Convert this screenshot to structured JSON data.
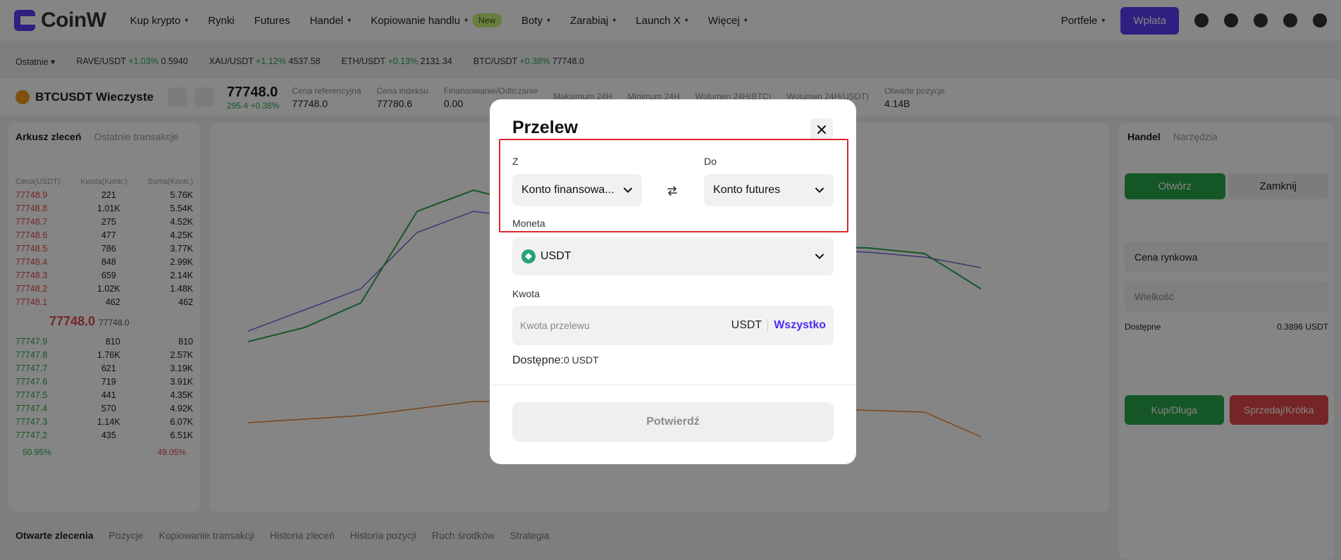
{
  "nav": {
    "brand": "CoinW",
    "items": [
      "Kup krypto",
      "Rynki",
      "Futures",
      "Handel",
      "Kopiowanie handlu",
      "Boty",
      "Zarabiaj",
      "Launch X",
      "Więcej"
    ],
    "new_badge": "New",
    "wallets": "Portfele",
    "deposit": "Wpłata"
  },
  "ticker": {
    "recent": "Ostatnie",
    "items": [
      {
        "pair": "RAVE/USDT",
        "change": "+1.03%",
        "price": "0.5940"
      },
      {
        "pair": "XAU/USDT",
        "change": "+1.12%",
        "price": "4537.58"
      },
      {
        "pair": "ETH/USDT",
        "change": "+0.13%",
        "price": "2131.34"
      },
      {
        "pair": "BTC/USDT",
        "change": "+0.38%",
        "price": "77748.0"
      }
    ]
  },
  "symbol": {
    "name": "BTCUSDT Wieczyste",
    "price": "77748.0",
    "change": "295.4 +0.38%",
    "stats": [
      {
        "label": "Cena referencyjna",
        "value": "77748.0"
      },
      {
        "label": "Cena indeksu",
        "value": "77780.6"
      },
      {
        "label": "Finansowanie/Odliczanie",
        "value": "0.00"
      },
      {
        "label": "Maksimum 24H",
        "value": ""
      },
      {
        "label": "Minimum 24H",
        "value": ""
      },
      {
        "label": "Wolumen 24H(BTC)",
        "value": ""
      },
      {
        "label": "Wolumen 24H(USDT)",
        "value": ""
      },
      {
        "label": "Otwarte pozycje",
        "value": "4.14B"
      }
    ]
  },
  "orderbook": {
    "tab1": "Arkusz zleceń",
    "tab2": "Ostatnie transakcje",
    "headers": [
      "Cena(USDT)",
      "Kwota(Kontr.)",
      "Suma(Kontr.)"
    ],
    "asks": [
      [
        "77748.9",
        "221",
        "5.76K"
      ],
      [
        "77748.8",
        "1.01K",
        "5.54K"
      ],
      [
        "77748.7",
        "275",
        "4.52K"
      ],
      [
        "77748.6",
        "477",
        "4.25K"
      ],
      [
        "77748.5",
        "786",
        "3.77K"
      ],
      [
        "77748.4",
        "848",
        "2.99K"
      ],
      [
        "77748.3",
        "659",
        "2.14K"
      ],
      [
        "77748.2",
        "1.02K",
        "1.48K"
      ],
      [
        "77748.1",
        "462",
        "462"
      ]
    ],
    "mid": "77748.0",
    "mid_ref": "77748.0",
    "bids": [
      [
        "77747.9",
        "810",
        "810"
      ],
      [
        "77747.8",
        "1.76K",
        "2.57K"
      ],
      [
        "77747.7",
        "621",
        "3.19K"
      ],
      [
        "77747.6",
        "719",
        "3.91K"
      ],
      [
        "77747.5",
        "441",
        "4.35K"
      ],
      [
        "77747.4",
        "570",
        "4.92K"
      ],
      [
        "77747.3",
        "1.14K",
        "6.07K"
      ],
      [
        "77747.2",
        "435",
        "6.51K"
      ]
    ],
    "buy_ratio": "50.95%",
    "sell_ratio": "49.05%"
  },
  "bottom_tabs": [
    "Otwarte zlecenia",
    "Pozycje",
    "Kopiowanie transakcji",
    "Historia zleceń",
    "Historia pozycji",
    "Ruch środków",
    "Strategia"
  ],
  "right_panel": {
    "tab": "Handel",
    "tab2": "Narzędzia",
    "open": "Otwórz",
    "close": "Zamknij",
    "buy": "Kup/Długa",
    "sell": "Sprzedaj/Krótka",
    "market_price": "Cena rynkowa",
    "size": "Wielkość",
    "available": "Dostępne",
    "available_value": "0.3896 USDT"
  },
  "modal": {
    "title": "Przelew",
    "from_label": "Z",
    "from_value": "Konto finansowa...",
    "to_label": "Do",
    "to_value": "Konto futures",
    "coin_label": "Moneta",
    "coin_value": "USDT",
    "amount_label": "Kwota",
    "amount_placeholder": "Kwota przelewu",
    "amount_unit": "USDT",
    "all_button": "Wszystko",
    "available_label": "Dostępne:",
    "available_value": "0 USDT",
    "confirm_button": "Potwierdź"
  }
}
